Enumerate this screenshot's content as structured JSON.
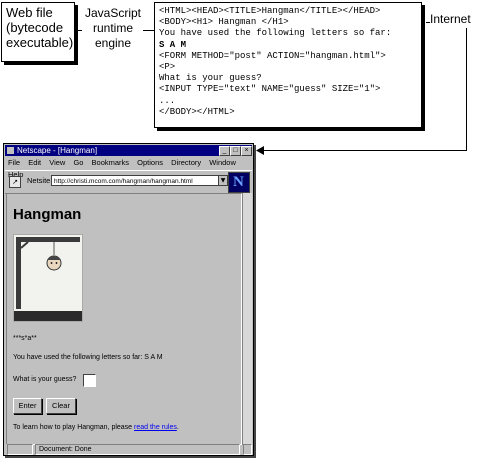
{
  "diagram": {
    "web_file_label": [
      "Web file",
      "(bytecode",
      "executable)"
    ],
    "engine_label": [
      "JavaScript",
      "runtime",
      "engine"
    ],
    "internet_label": "Internet",
    "code_lines": [
      {
        "text": "<HTML><HEAD><TITLE>Hangman</TITLE></HEAD>",
        "bold": false
      },
      {
        "text": "<BODY><H1> Hangman </H1>",
        "bold": false
      },
      {
        "text": "You have used the following letters so far:",
        "bold": false
      },
      {
        "text": "S A M",
        "bold": true
      },
      {
        "text": "<FORM METHOD=\"post\" ACTION=\"hangman.html\">",
        "bold": false
      },
      {
        "text": "<P>",
        "bold": false
      },
      {
        "text": "What is your guess?",
        "bold": false
      },
      {
        "text": "<INPUT TYPE=\"text\" NAME=\"guess\" SIZE=\"1\">",
        "bold": false
      },
      {
        "text": "...",
        "bold": false
      },
      {
        "text": "</BODY></HTML>",
        "bold": false
      }
    ]
  },
  "browser": {
    "window_title": "Netscape - [Hangman]",
    "window_buttons": [
      "_",
      "□",
      "×"
    ],
    "menu": [
      "File",
      "Edit",
      "View",
      "Go",
      "Bookmarks",
      "Options",
      "Directory",
      "Window",
      "Help"
    ],
    "location_label": "Netsite:",
    "location_url": "http://christi.mcom.com/hangman/hangman.html",
    "page": {
      "title": "Hangman",
      "word_progress": "***s*a**",
      "letters_used": "You have used the following letters so far: S A M",
      "guess_prompt": "What is your guess?",
      "enter_label": "Enter",
      "clear_label": "Clear",
      "rules_prefix": "To learn how to play Hangman, please ",
      "rules_link": "read the rules",
      "rules_suffix": "."
    },
    "status_text": "Document: Done"
  },
  "colors": {
    "titlebar": "#000080",
    "window_bg": "#c0c0c0",
    "link": "#0000ee"
  }
}
